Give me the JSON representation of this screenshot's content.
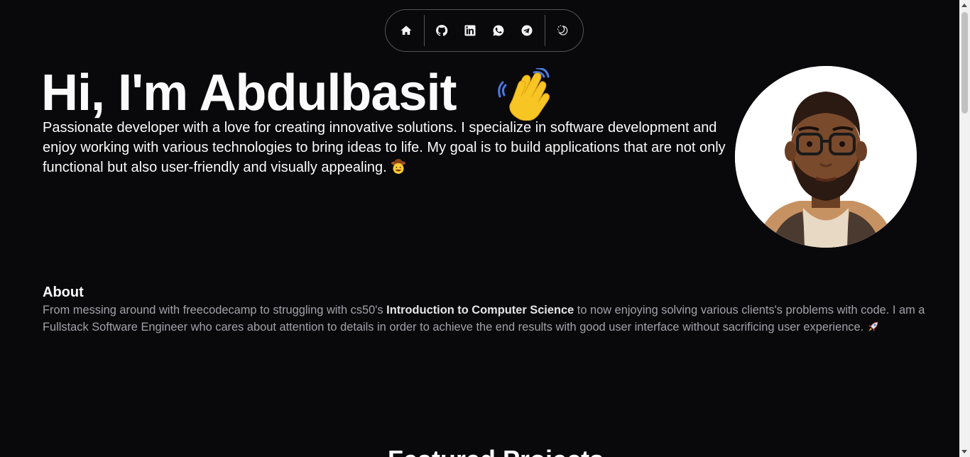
{
  "nav": {
    "items": [
      {
        "icon": "home-icon"
      },
      {
        "icon": "github-icon"
      },
      {
        "icon": "linkedin-icon"
      },
      {
        "icon": "whatsapp-icon"
      },
      {
        "icon": "telegram-icon"
      },
      {
        "icon": "theme-toggle-icon"
      }
    ]
  },
  "hero": {
    "title": "Hi, I'm Abdulbasit",
    "wave_icon": "waving-hand-icon",
    "intro": "Passionate developer with a love for creating innovative solutions. I specialize in software development and enjoy working with various technologies to bring ideas to life. My goal is to build applications that are not only functional but also user-friendly and visually appealing.",
    "intro_emoji": "cowboy-face-icon",
    "avatar": "avatar"
  },
  "about": {
    "heading": "About",
    "text_part1": "From messing around with freecodecamp to struggling with cs50's ",
    "text_bold": "Introduction to Computer Science",
    "text_part2": " to now enjoying solving various clients's problems with code. I am a Fullstack Software Engineer who cares about attention to details in order to achieve the end results with good user interface without sacrificing user experience.",
    "text_emoji": "rocket-icon"
  },
  "next_section": {
    "heading": "Featured Projects"
  },
  "colors": {
    "background": "#09090b",
    "text": "#fafafa",
    "muted_text": "#a1a1aa",
    "border": "#52525b"
  }
}
